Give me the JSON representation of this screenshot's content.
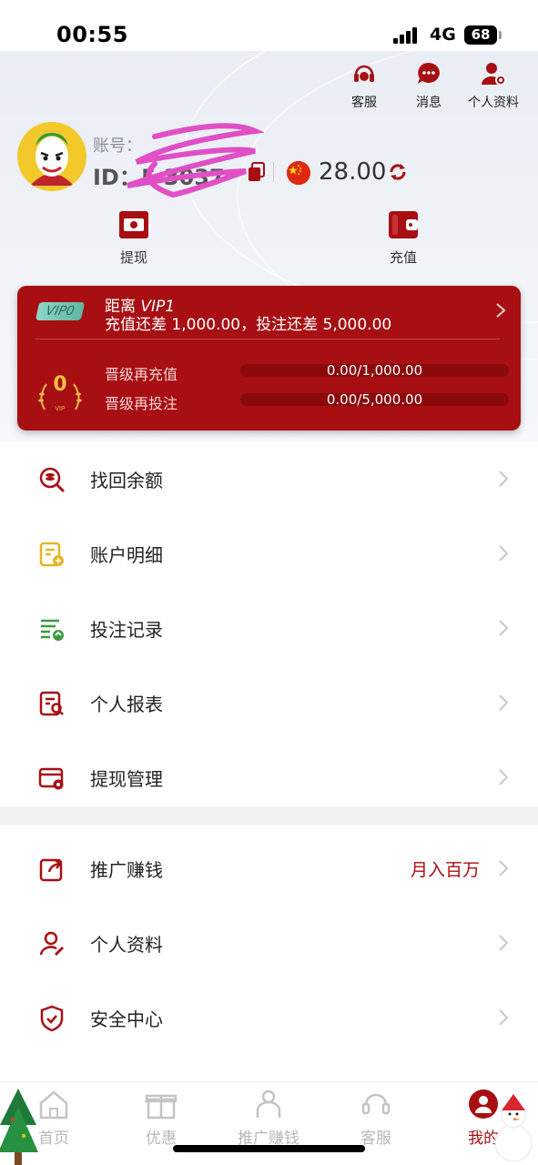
{
  "status_bar": {
    "time": "00:55",
    "network": "4G",
    "battery": "68"
  },
  "header": {
    "actions": [
      {
        "label": "客服",
        "icon": "headset-icon"
      },
      {
        "label": "消息",
        "icon": "message-icon"
      },
      {
        "label": "个人资料",
        "icon": "profile-icon"
      }
    ],
    "account_label": "账号：",
    "id_label": "ID：5      3037",
    "balance": "28.00",
    "currency_icon": "china-flag-icon",
    "withdraw_label": "提现",
    "deposit_label": "充值"
  },
  "vip": {
    "badge": "VIP0",
    "target_prefix": "距离",
    "target_level": "VIP1",
    "diff_text": "充值还差 1,000.00，投注还差 5,000.00",
    "level_number": "0",
    "deposit_label": "晋级再充值",
    "deposit_value": "0.00/1,000.00",
    "deposit_progress": 0,
    "bet_label": "晋级再投注",
    "bet_value": "0.00/5,000.00",
    "bet_progress": 0,
    "accent_color": "#a70f12"
  },
  "menu": [
    {
      "label": "找回余额",
      "icon": "coins-search-icon"
    },
    {
      "label": "账户明细",
      "icon": "account-detail-icon"
    },
    {
      "label": "投注记录",
      "icon": "bet-record-icon"
    },
    {
      "label": "个人报表",
      "icon": "report-icon"
    },
    {
      "label": "提现管理",
      "icon": "withdraw-manage-icon"
    }
  ],
  "menu2": [
    {
      "label": "推广赚钱",
      "icon": "share-icon",
      "extra": "月入百万"
    },
    {
      "label": "个人资料",
      "icon": "user-edit-icon",
      "extra": ""
    },
    {
      "label": "安全中心",
      "icon": "shield-icon",
      "extra": ""
    }
  ],
  "tabs": [
    {
      "label": "首页",
      "icon": "home-icon"
    },
    {
      "label": "优惠",
      "icon": "gift-icon"
    },
    {
      "label": "推广赚钱",
      "icon": "promote-icon"
    },
    {
      "label": "客服",
      "icon": "headset-icon"
    },
    {
      "label": "我的",
      "icon": "mine-icon",
      "active": true
    }
  ]
}
